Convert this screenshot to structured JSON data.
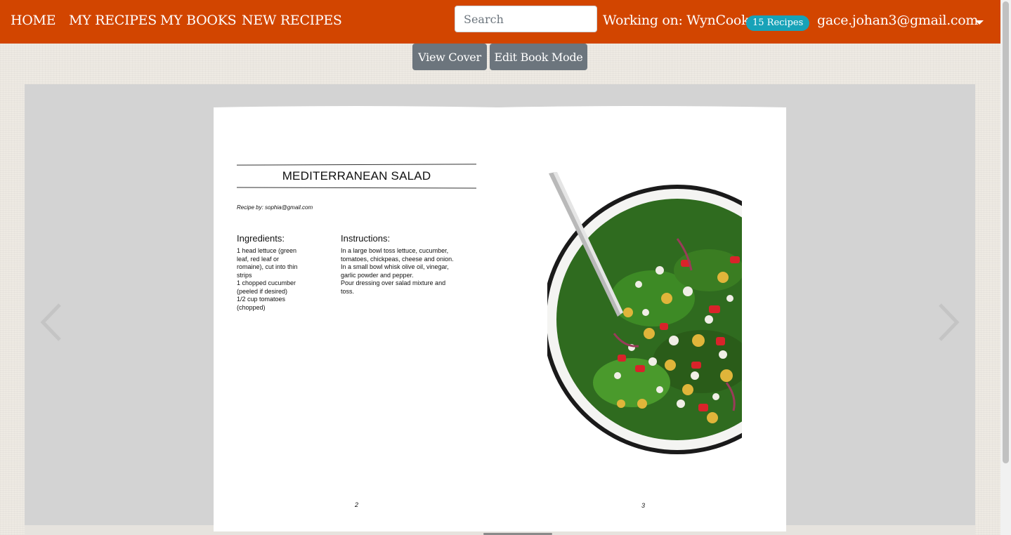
{
  "navbar": {
    "links": [
      "HOME",
      "MY RECIPES",
      "MY BOOKS",
      "NEW RECIPES"
    ],
    "search_placeholder": "Search",
    "working_on": "Working on: WynCook",
    "recipe_count_badge": "15 Recipes",
    "user_email": "gace.johan3@gmail.com",
    "bar_color": "#d24500"
  },
  "toolbar": {
    "view_cover_label": "View Cover",
    "edit_book_mode_label": "Edit Book Mode"
  },
  "book": {
    "recipe_title": "MEDITERRANEAN SALAD",
    "recipe_by": "Recipe by: sophia@gmail.com",
    "ingredients_heading": "Ingredients:",
    "ingredients_lines": [
      "1 head lettuce (green",
      "leaf, red leaf or",
      "romaine), cut into thin",
      "strips",
      "1 chopped cucumber",
      "(peeled if desired)",
      "1/2 cup tomatoes",
      "(chopped)"
    ],
    "instructions_heading": "Instructions:",
    "instructions_lines": [
      "In a large bowl toss lettuce, cucumber,",
      "tomatoes, chickpeas, cheese and onion.",
      "In a small bowl whisk olive oil, vinegar,",
      "garlic powder and pepper.",
      "Pour dressing over salad mixture and",
      "toss."
    ],
    "left_page_number": "2",
    "right_page_number": "3",
    "image_icon": "salad-bowl-image"
  },
  "navigation": {
    "prev_icon": "chevron-left-icon",
    "next_icon": "chevron-right-icon"
  }
}
